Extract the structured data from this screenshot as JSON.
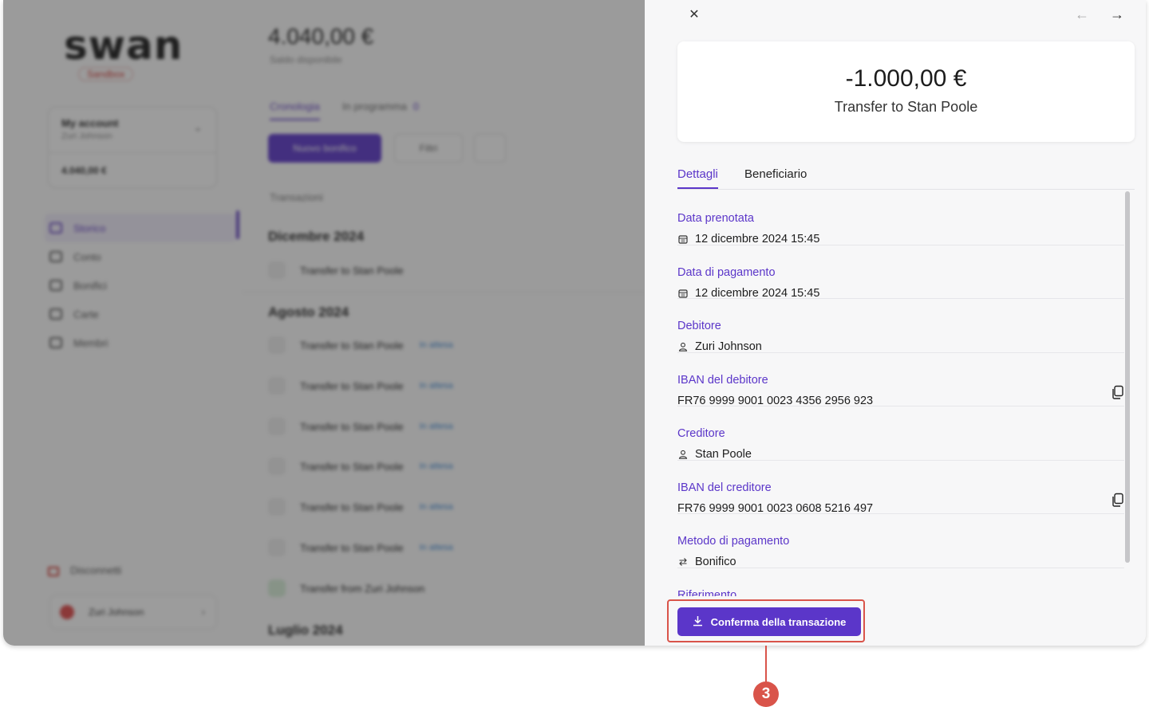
{
  "background": {
    "logo": "swan",
    "environment_badge": "Sandbox",
    "account": {
      "name": "My account",
      "holder": "Zuri Johnson",
      "balance": "4.040,00 €"
    },
    "nav": [
      "Storico",
      "Conto",
      "Bonifici",
      "Carte",
      "Membri"
    ],
    "logout_label": "Disconnetti",
    "user_name": "Zuri Johnson",
    "balance": "4.040,00 €",
    "balance_label": "Saldo disponibile",
    "tabs": {
      "history": "Cronologia",
      "scheduled": "In programma",
      "scheduled_count": "0"
    },
    "new_transfer_label": "Nuovo bonifico",
    "filter_label": "Filtri",
    "transactions_label": "Transazioni",
    "months": [
      "Dicembre 2024",
      "Agosto 2024",
      "Luglio 2024"
    ],
    "transactions": [
      {
        "label": "Transfer to Stan Poole",
        "status": ""
      },
      {
        "label": "Transfer to Stan Poole",
        "status": "In attesa"
      },
      {
        "label": "Transfer to Stan Poole",
        "status": "In attesa"
      },
      {
        "label": "Transfer to Stan Poole",
        "status": "In attesa"
      },
      {
        "label": "Transfer to Stan Poole",
        "status": "In attesa"
      },
      {
        "label": "Transfer to Stan Poole",
        "status": "In attesa"
      },
      {
        "label": "Transfer to Stan Poole",
        "status": "In attesa"
      },
      {
        "label": "Transfer from Zuri Johnson",
        "status": ""
      }
    ]
  },
  "panel": {
    "amount": "-1.000,00 €",
    "title": "Transfer to Stan Poole",
    "tabs": {
      "details": "Dettagli",
      "beneficiary": "Beneficiario"
    },
    "details": [
      {
        "label": "Data prenotata",
        "value": "12 dicembre 2024 15:45",
        "icon": "calendar-icon"
      },
      {
        "label": "Data di pagamento",
        "value": "12 dicembre 2024 15:45",
        "icon": "calendar-icon"
      },
      {
        "label": "Debitore",
        "value": "Zuri Johnson",
        "icon": "user-icon"
      },
      {
        "label": "IBAN del debitore",
        "value": "FR76 9999 9001 0023 4356 2956 923",
        "icon": ""
      },
      {
        "label": "Creditore",
        "value": "Stan Poole",
        "icon": "user-icon"
      },
      {
        "label": "IBAN del creditore",
        "value": "FR76 9999 9001 0023 0608 5216 497",
        "icon": ""
      },
      {
        "label": "Metodo di pagamento",
        "value": "Bonifico",
        "icon": "swap-icon"
      },
      {
        "label": "Riferimento",
        "value": "",
        "icon": ""
      }
    ],
    "confirm_button": "Conferma della transazione"
  },
  "annotation": {
    "step": "3"
  },
  "colors": {
    "accent": "#5b36c9",
    "annotation": "#d9544a"
  }
}
